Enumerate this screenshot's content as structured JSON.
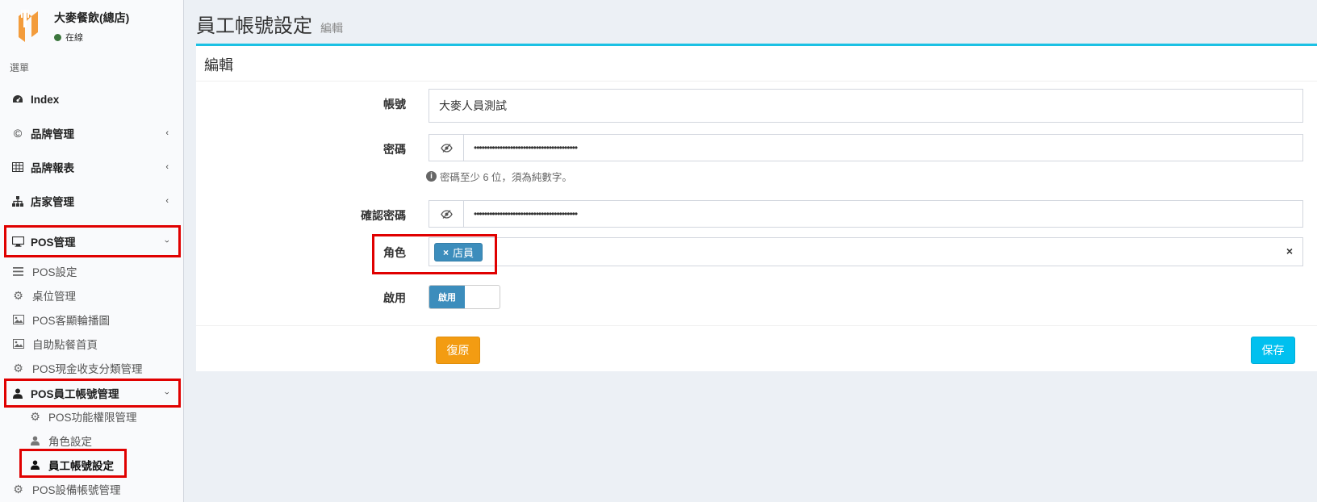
{
  "brand": {
    "name": "大麥餐飲(總店)",
    "status": "在線",
    "status_color": "#3c763d",
    "logo_color": "#f39c3c"
  },
  "menu_header": "選單",
  "nav": {
    "index": {
      "label": "Index",
      "icon": "dashboard-icon"
    },
    "brand_mgmt": {
      "label": "品牌管理",
      "icon": "copyright-icon"
    },
    "brand_report": {
      "label": "品牌報表",
      "icon": "table-icon"
    },
    "store_mgmt": {
      "label": "店家管理",
      "icon": "sitemap-icon"
    },
    "pos_mgmt": {
      "label": "POS管理",
      "icon": "desktop-icon"
    },
    "pos_settings": {
      "label": "POS設定",
      "icon": "bars-icon"
    },
    "table_mgmt": {
      "label": "桌位管理",
      "icon": "gear-icon"
    },
    "pos_carousel": {
      "label": "POS客顯輪播圖",
      "icon": "image-icon"
    },
    "self_order_home": {
      "label": "自助點餐首頁",
      "icon": "image-icon"
    },
    "pos_cash": {
      "label": "POS現金收支分類管理",
      "icon": "gear-icon"
    },
    "pos_staff": {
      "label": "POS員工帳號管理",
      "icon": "user-icon"
    },
    "pos_permission": {
      "label": "POS功能權限管理",
      "icon": "gear-icon"
    },
    "role_settings": {
      "label": "角色設定",
      "icon": "user-icon"
    },
    "staff_account": {
      "label": "員工帳號設定",
      "icon": "user-icon"
    },
    "pos_device": {
      "label": "POS設備帳號管理",
      "icon": "gear-icon"
    }
  },
  "page": {
    "title": "員工帳號設定",
    "subtitle": "編輯"
  },
  "box": {
    "title": "編輯"
  },
  "form": {
    "account_label": "帳號",
    "account_value": "大麥人員測試",
    "password_label": "密碼",
    "password_value": "••••••••••••••••••••••••••••••••••••••••",
    "password_help": "密碼至少 6 位，須為純數字。",
    "confirm_label": "確認密碼",
    "confirm_value": "••••••••••••••••••••••••••••••••••••••••",
    "role_label": "角色",
    "role_tag": "店員",
    "enable_label": "啟用",
    "enable_toggle": "啟用"
  },
  "buttons": {
    "reset": "復原",
    "save": "保存"
  },
  "colors": {
    "accent": "#1cc1e4",
    "tag": "#3c8dbc",
    "reset": "#f39c12",
    "save": "#00c0ef",
    "highlight": "#e00000"
  }
}
